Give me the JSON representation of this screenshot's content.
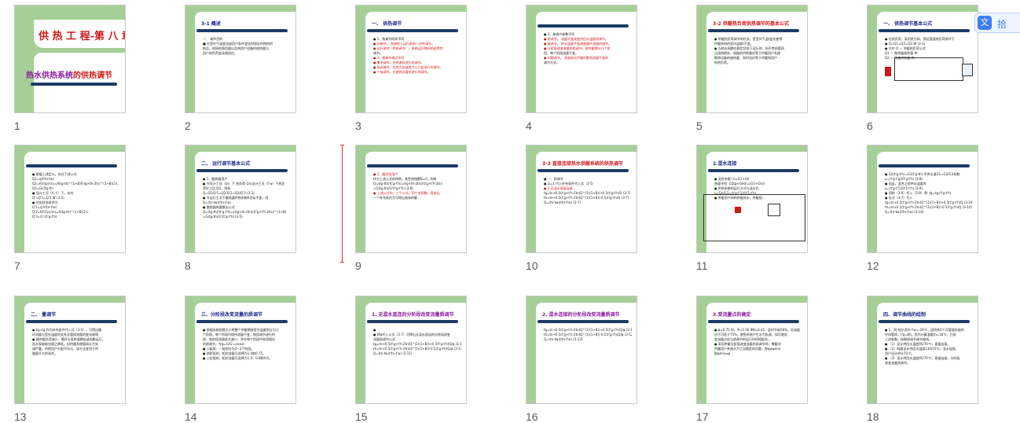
{
  "slides": [
    {
      "number": "1",
      "title": "供 热 工 程-第 八 章",
      "subtitle_a": "热水供热系统",
      "subtitle_b": "的供热调节",
      "lines": []
    },
    {
      "number": "2",
      "title": "3-1 概述",
      "lines": [
        "一、   调节目的",
        "■ 在室外气温变化或用户条件变化时保证供热的供",
        "   热品。热网的热用量以及热用户设备的放热量与",
        "   用户热负荷变化相适应。"
      ]
    },
    {
      "number": "3",
      "title": "一、 供热调节",
      "lines": [
        "● 1、按调节时间不同",
        "● 初调节。 系统投入运行前的一次性调节。",
        "● 运行调节（供热调节）。系统运行期间的经常性",
        "   调节。",
        "● 2、按调节地点不同",
        "● 集中调节。在热源处进行的调节。",
        "● 局部调节。在热力站或热力入口处进行的调节。",
        "● 个体调节。在散热设备处进行的调节。"
      ]
    },
    {
      "number": "4",
      "title": "",
      "lines": [
        "● 3、按调节参数不同",
        "● 质调节。 流量不变改变供回水温度的调节。",
        "● 量调节。 供水温度不变改变循环流量的调节。",
        "● 分阶段改变流量的质调节。按供暖期分几个阶",
        "   段，每个阶段流量不变。",
        "● 间歇调节。 改变每天供暖时数而流量不变的",
        "   调节方式。"
      ]
    },
    {
      "number": "5",
      "title": "3-2 供暖热负荷供热调节的基本公式",
      "lines": [
        "● 供暖热负荷调节的任务，是室外气温t变化使得",
        "   供暖房间的室内温度t不变。",
        "● 当热水网路在稳定状态下运行时，如不考虑管网",
        "   沿途热损失，网路的供热量应等于供暖用户系统",
        "   散热设备的放热量，同时也应等于供暖热用户",
        "   的热负荷。"
      ]
    },
    {
      "number": "6",
      "title": "一、   供热调节基本公式",
      "lines": [
        "● 在热负荷、采用热力网、保证管道热负荷条件下",
        "● Q=Q1=Q2=Q3     W       (3-1)",
        "● 式中 Q — 供暖热负荷公式",
        "   Q1 — 散热器放热量 W",
        "   Q2 — 网络供热量 W"
      ]
    },
    {
      "number": "7",
      "title": "",
      "lines": [
        "● 根据上述定义，存在下述公式",
        "   Q1=qV(tn-tw)",
        "   Q2=KF(tpj-tn)=A(tg-th)^(1+B)F(tg+th-2tn)^(1+B)/2·L",
        "   Q3=Gc(tg-th)",
        "● 设计工况（ti, t'）下，存在",
        "   Q'=Q'1=Q'2      W      (3-2)",
        "● 对应状态条件为",
        "   Q'1=q'V(tn-t'w)",
        "   Q'2=KF(t'pj-tn)=A(tg-th)^(1+B)/2·L",
        "   Q'3=G'c(t'g-t'h)"
      ]
    },
    {
      "number": "8",
      "title": "二、 运行调节基本公式",
      "lines": [
        "● 1、散热器用户",
        "● 令设计工况（tn）下 热负荷 Q与设计工况（t'w）下热负",
        "   荷Q'之比为Q，则有",
        "   Q=Q1/Q'1=Q2/Q'2=Q3/Q'3       (3-3)",
        "● 令运行工况下散热器传热系数K近似不变，则",
        "   Q=(tn-tw)/(tn-t'w)",
        "● 散热器热量散出公式",
        "   Q=(tg-th)/(t'g-t'h)=((tg+th-2tn)/(t'g+t'h-2tn))^(1+B)",
        "   =G(tg-th)/G'(t'g-t'h)     (3-5)"
      ]
    },
    {
      "number": "9",
      "title": "",
      "lines": [
        "● 2、暖风机用户",
        "   作为上述公式的特例，其传热指数B=0，则有",
        "   Q=(tg-th)/(t'g-t'h)=(tg+th-2tn)/(t'g+t'h-2tn)",
        "   =G(tg-th)/G'(t'g-t'h)          (3-8)",
        "● 上述公式中，三个公式，四个未知数，再给出",
        "   一个补充条件方可得出具体的解"
      ]
    },
    {
      "number": "10",
      "title": "3-3 直接连接热水供暖系统的供热调节",
      "lines": [
        "● 一、质调节",
        "● G=1 代入补充条件代入式（3-5）",
        "● 1.无混水直接连接",
        "   tg=tn+0.5(t'g+t'h-2tn)Q^(1/(1+B))+0.5(t'g-t'h)Q   (3-7)",
        "   th=tn+0.5(t'g+t'h-2tn)Q^(1/(1+B))-0.5(t'g-t'h)Q   (3-7)",
        "   Q=(tn-tw)/(tn-t'w)                (3-7)"
      ]
    },
    {
      "number": "11",
      "title": "2.混水连接",
      "lines": [
        "● 混合系数: G=G1+Gh",
        "   热量守恒: G1tg+Ghth=(G1+Gh)t",
        "● 供热系统的运行方式与混水比",
        "   u=Gh/G1=(t'g-t'1)/(t'1-t'h)",
        "● 供暖用户网的供暖热水，供暖规..."
      ]
    },
    {
      "number": "12",
      "title": "",
      "lines": [
        "● G2(t'g-t'h)=G1(t'g-th) 令供水温G1=G2/G3系数:",
        "   u=(t'g-t'g)/(t'g-t'h)          (3-8)",
        "● 因此，混合之前供水温度时",
        "   u=(t'g-t'1)/(t'1-t'h)          (3-9)",
        "● 同样（3-9）代入（3-9）得: tg=tg·(t'g-t'h)",
        "● 在式（3-7）代入",
        "   tg=tn+0.5(t'g+t'h-2tn)Q^(1/(1+B))+0.5(t'g-t'h)Q   (3-10)",
        "   th=tn+0.5(t'g+t'h-2tn)Q^(1/(1+B))-0.5(t'g-t'h)Q   (3-10)",
        "   Q=(tn-tw)/(tn-t'w)               (3-10)"
      ]
    },
    {
      "number": "13",
      "title": "二、   量调节",
      "lines": [
        "● tg=tg 作为补充条件代入式（3-5），可得出循",
        "   环流量与室外温度的关系及管网流量的变化规律",
        "● 随供暖负荷减少，循环水泵转速降低或间歇运行，",
        "   而水泵能耗也随之降低，但供暖系统管网水力失",
        "   调严重，供热用户分配不均匀，该方法宜用于供",
        "   暖量不大的场合。"
      ]
    },
    {
      "number": "14",
      "title": "三、分阶段改变流量的质调节",
      "lines": [
        "● 根据系统规模大小将整个供暖期按室外温度划分为几",
        "   个阶段，每个阶段内保持流量不变，按质调节进行供",
        "   热，各阶段流量依次减小，并在每个阶段中采用相应",
        "   的质调节，令φ=G/G'=const",
        "● 二级泵：一般划分为2~3个阶段。",
        "● 两阶段时，相对流量可选择为1.0和0.75。",
        "● 三阶段时，相对流量可选择为1.0、0.8和0.6。"
      ]
    },
    {
      "number": "15",
      "title": "1. 无混水直连的分阶段改变流量质调节",
      "lines": [
        "●",
        "● 将φ代入公式（3-7）可得出无混水直连的分阶段改变",
        "   流量质调节公式",
        "   tg=tn+0.5(t'g+t'h-2tn)Q^(1/(1+B))+0.5(t'g-t'h)Q/φ  (3-11)",
        "   th=tn+0.5(t'g+t'h-2tn)Q^(1/(1+B))-0.5(t'g-t'h)Q/φ  (3-11)",
        "   Q=(tn-tw)/(tn-t'w)               (3-11)"
      ]
    },
    {
      "number": "16",
      "title": "2. 混水连接的分阶段改变流量质调节",
      "lines": [
        "   tg=tn+0.5(t'g+t'h-2tn)Q^(1/(1+B))+0.5(t'g-t'h)Q/φ  (3-12)",
        "   th=tn+0.5(t'g+t'h-2tn)Q^(1/(1+B))-0.5(t'g-t'h)Q/φ  (3-12)",
        "   Q=(tn-tw)/(tn-t'w)               (3-12)"
      ]
    },
    {
      "number": "17",
      "title": "3.变流量点的确定",
      "lines": [
        "● φ=0.75 时，Ψ=0.56  ΦN=0.42，此时节电58%。总流量",
        "   应不可低于75%，避免系统产生水力失调，如可继续",
        "   变流量点应与质调节的运行时间相配合。",
        "● 采用供暖分阶段改变流量的质调节时，需解决",
        "   供暖用户系统水力工况稳定的问题，即φ≥φmin",
        "   取φmin≥φ"
      ]
    },
    {
      "number": "18",
      "title": "四、调节曲线的绘制",
      "lines": [
        "● 1、例 哈尔滨市 t'w=-26℃，因供热5个月管理实施的",
        "   中间管网，t'g=80，室内计算温度tn=18℃，已知",
        "   上述参数，绘制质调节调节曲线。",
        "● （1）设计供回水温度95/70℃，直接连接。",
        "● （2）网路设计供回水温度130/70℃，混水连接，",
        "   用户设计供水70℃。",
        "● （3）设计供回水温度95/70℃，直接连接，分阶段",
        "   改变流量质调节。"
      ]
    }
  ],
  "colors": {
    "green": "#a5cf97",
    "navy": "#1c3b66",
    "title_blue": "#1c2d86",
    "title_red": "#d01818",
    "title_purple": "#8a1a9c",
    "highlight_red": "#d01818"
  },
  "translate_button": {
    "icon": "translate-icon",
    "label": "拾"
  }
}
